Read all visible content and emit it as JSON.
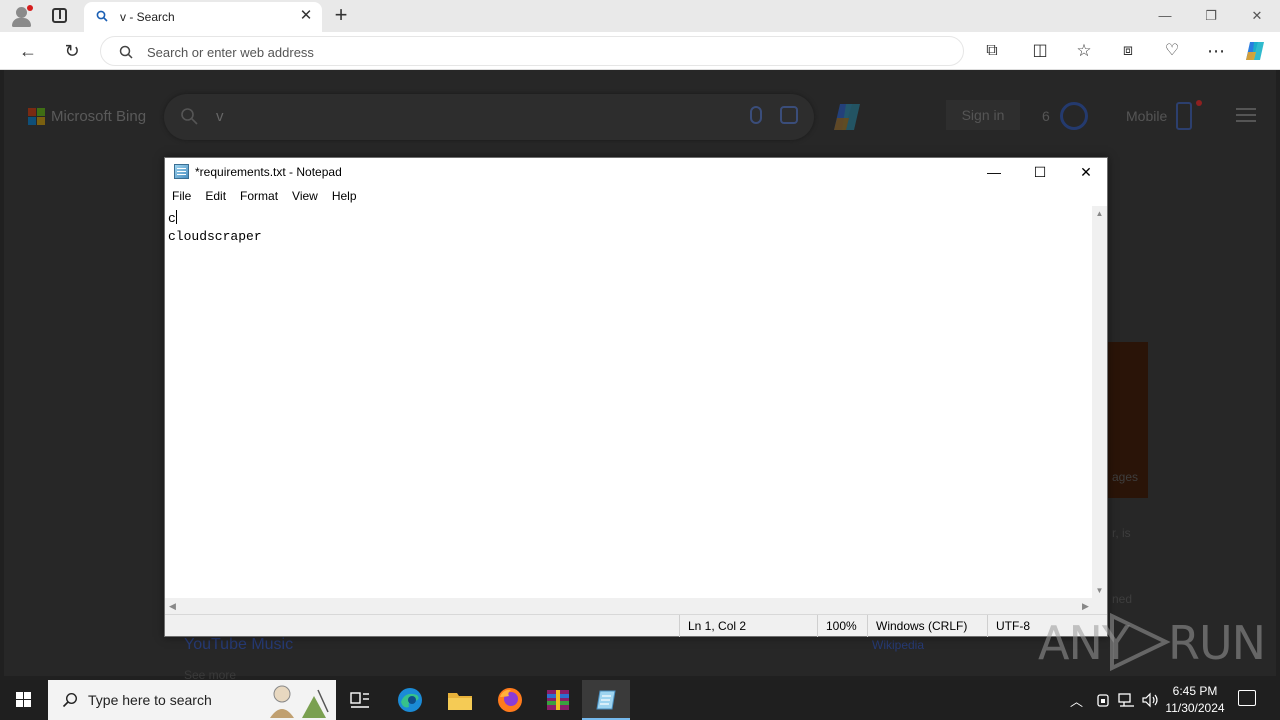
{
  "browser": {
    "tab_title": "v - Search",
    "address_placeholder": "Search or enter web address"
  },
  "bing": {
    "logo_text": "Microsoft Bing",
    "query": "v",
    "signin_label": "Sign in",
    "rewards_count": "6",
    "mobile_label": "Mobile",
    "side_text_1": "ages",
    "side_text_2": "r, is",
    "side_text_3": "ned",
    "youtube_music": "YouTube Music",
    "youtube_sub": "See more",
    "wikipedia": "Wikipedia"
  },
  "notepad": {
    "title": "*requirements.txt - Notepad",
    "menu": [
      "File",
      "Edit",
      "Format",
      "View",
      "Help"
    ],
    "lines": [
      "c",
      "cloudscraper"
    ],
    "status": {
      "position": "Ln 1, Col 2",
      "zoom": "100%",
      "line_ending": "Windows (CRLF)",
      "encoding": "UTF-8"
    }
  },
  "taskbar": {
    "search_placeholder": "Type here to search",
    "time": "6:45 PM",
    "date": "11/30/2024"
  },
  "watermark": {
    "left": "ANY",
    "right": "RUN"
  },
  "icons": {
    "profile": "profile-icon",
    "tabs": "tab-actions-icon",
    "back": "back-icon",
    "refresh": "refresh-icon",
    "extensions": "extensions-icon",
    "split": "split-screen-icon",
    "favorites": "favorites-icon",
    "collections": "collections-icon",
    "performance": "browser-essentials-icon",
    "more": "more-icon",
    "copilot": "copilot-icon"
  },
  "colors": {
    "accent": "#0078d4",
    "taskbar": "#1f1f1f",
    "active_app_indicator": "#76b9ed"
  }
}
